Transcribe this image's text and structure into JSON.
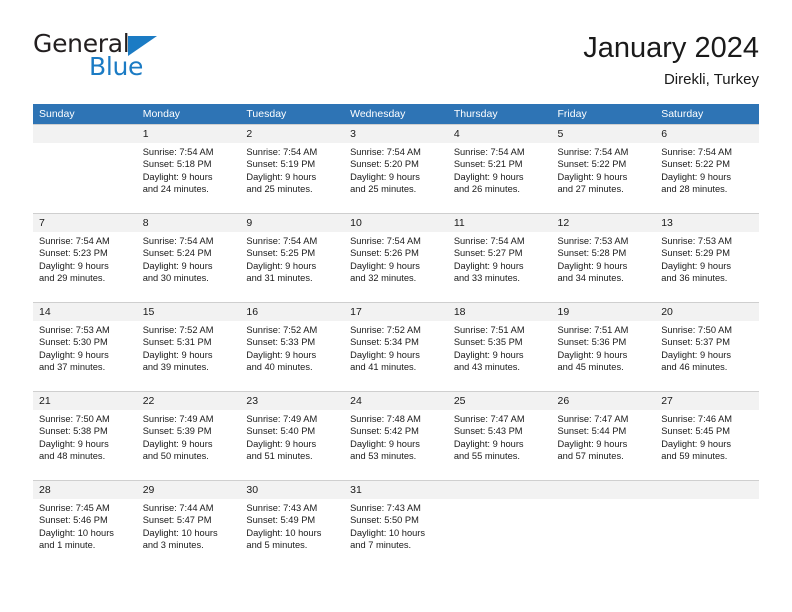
{
  "brand": {
    "name_top": "General",
    "name_bottom": "Blue",
    "triangle_color": "#1b7bc4",
    "text_color": "#231f20"
  },
  "header": {
    "title": "January 2024",
    "subtitle": "Direkli, Turkey"
  },
  "theme": {
    "header_bg": "#2e74b5",
    "header_text": "#ffffff",
    "daynum_bg": "#f2f2f2",
    "cell_bg": "#ffffff",
    "grid_line": "#cfcfcf",
    "text": "#1a1a1a"
  },
  "calendar": {
    "columns": [
      "Sunday",
      "Monday",
      "Tuesday",
      "Wednesday",
      "Thursday",
      "Friday",
      "Saturday"
    ],
    "weeks": [
      [
        {
          "day": "",
          "lines": []
        },
        {
          "day": "1",
          "lines": [
            "Sunrise: 7:54 AM",
            "Sunset: 5:18 PM",
            "Daylight: 9 hours",
            "and 24 minutes."
          ]
        },
        {
          "day": "2",
          "lines": [
            "Sunrise: 7:54 AM",
            "Sunset: 5:19 PM",
            "Daylight: 9 hours",
            "and 25 minutes."
          ]
        },
        {
          "day": "3",
          "lines": [
            "Sunrise: 7:54 AM",
            "Sunset: 5:20 PM",
            "Daylight: 9 hours",
            "and 25 minutes."
          ]
        },
        {
          "day": "4",
          "lines": [
            "Sunrise: 7:54 AM",
            "Sunset: 5:21 PM",
            "Daylight: 9 hours",
            "and 26 minutes."
          ]
        },
        {
          "day": "5",
          "lines": [
            "Sunrise: 7:54 AM",
            "Sunset: 5:22 PM",
            "Daylight: 9 hours",
            "and 27 minutes."
          ]
        },
        {
          "day": "6",
          "lines": [
            "Sunrise: 7:54 AM",
            "Sunset: 5:22 PM",
            "Daylight: 9 hours",
            "and 28 minutes."
          ]
        }
      ],
      [
        {
          "day": "7",
          "lines": [
            "Sunrise: 7:54 AM",
            "Sunset: 5:23 PM",
            "Daylight: 9 hours",
            "and 29 minutes."
          ]
        },
        {
          "day": "8",
          "lines": [
            "Sunrise: 7:54 AM",
            "Sunset: 5:24 PM",
            "Daylight: 9 hours",
            "and 30 minutes."
          ]
        },
        {
          "day": "9",
          "lines": [
            "Sunrise: 7:54 AM",
            "Sunset: 5:25 PM",
            "Daylight: 9 hours",
            "and 31 minutes."
          ]
        },
        {
          "day": "10",
          "lines": [
            "Sunrise: 7:54 AM",
            "Sunset: 5:26 PM",
            "Daylight: 9 hours",
            "and 32 minutes."
          ]
        },
        {
          "day": "11",
          "lines": [
            "Sunrise: 7:54 AM",
            "Sunset: 5:27 PM",
            "Daylight: 9 hours",
            "and 33 minutes."
          ]
        },
        {
          "day": "12",
          "lines": [
            "Sunrise: 7:53 AM",
            "Sunset: 5:28 PM",
            "Daylight: 9 hours",
            "and 34 minutes."
          ]
        },
        {
          "day": "13",
          "lines": [
            "Sunrise: 7:53 AM",
            "Sunset: 5:29 PM",
            "Daylight: 9 hours",
            "and 36 minutes."
          ]
        }
      ],
      [
        {
          "day": "14",
          "lines": [
            "Sunrise: 7:53 AM",
            "Sunset: 5:30 PM",
            "Daylight: 9 hours",
            "and 37 minutes."
          ]
        },
        {
          "day": "15",
          "lines": [
            "Sunrise: 7:52 AM",
            "Sunset: 5:31 PM",
            "Daylight: 9 hours",
            "and 39 minutes."
          ]
        },
        {
          "day": "16",
          "lines": [
            "Sunrise: 7:52 AM",
            "Sunset: 5:33 PM",
            "Daylight: 9 hours",
            "and 40 minutes."
          ]
        },
        {
          "day": "17",
          "lines": [
            "Sunrise: 7:52 AM",
            "Sunset: 5:34 PM",
            "Daylight: 9 hours",
            "and 41 minutes."
          ]
        },
        {
          "day": "18",
          "lines": [
            "Sunrise: 7:51 AM",
            "Sunset: 5:35 PM",
            "Daylight: 9 hours",
            "and 43 minutes."
          ]
        },
        {
          "day": "19",
          "lines": [
            "Sunrise: 7:51 AM",
            "Sunset: 5:36 PM",
            "Daylight: 9 hours",
            "and 45 minutes."
          ]
        },
        {
          "day": "20",
          "lines": [
            "Sunrise: 7:50 AM",
            "Sunset: 5:37 PM",
            "Daylight: 9 hours",
            "and 46 minutes."
          ]
        }
      ],
      [
        {
          "day": "21",
          "lines": [
            "Sunrise: 7:50 AM",
            "Sunset: 5:38 PM",
            "Daylight: 9 hours",
            "and 48 minutes."
          ]
        },
        {
          "day": "22",
          "lines": [
            "Sunrise: 7:49 AM",
            "Sunset: 5:39 PM",
            "Daylight: 9 hours",
            "and 50 minutes."
          ]
        },
        {
          "day": "23",
          "lines": [
            "Sunrise: 7:49 AM",
            "Sunset: 5:40 PM",
            "Daylight: 9 hours",
            "and 51 minutes."
          ]
        },
        {
          "day": "24",
          "lines": [
            "Sunrise: 7:48 AM",
            "Sunset: 5:42 PM",
            "Daylight: 9 hours",
            "and 53 minutes."
          ]
        },
        {
          "day": "25",
          "lines": [
            "Sunrise: 7:47 AM",
            "Sunset: 5:43 PM",
            "Daylight: 9 hours",
            "and 55 minutes."
          ]
        },
        {
          "day": "26",
          "lines": [
            "Sunrise: 7:47 AM",
            "Sunset: 5:44 PM",
            "Daylight: 9 hours",
            "and 57 minutes."
          ]
        },
        {
          "day": "27",
          "lines": [
            "Sunrise: 7:46 AM",
            "Sunset: 5:45 PM",
            "Daylight: 9 hours",
            "and 59 minutes."
          ]
        }
      ],
      [
        {
          "day": "28",
          "lines": [
            "Sunrise: 7:45 AM",
            "Sunset: 5:46 PM",
            "Daylight: 10 hours",
            "and 1 minute."
          ]
        },
        {
          "day": "29",
          "lines": [
            "Sunrise: 7:44 AM",
            "Sunset: 5:47 PM",
            "Daylight: 10 hours",
            "and 3 minutes."
          ]
        },
        {
          "day": "30",
          "lines": [
            "Sunrise: 7:43 AM",
            "Sunset: 5:49 PM",
            "Daylight: 10 hours",
            "and 5 minutes."
          ]
        },
        {
          "day": "31",
          "lines": [
            "Sunrise: 7:43 AM",
            "Sunset: 5:50 PM",
            "Daylight: 10 hours",
            "and 7 minutes."
          ]
        },
        {
          "day": "",
          "lines": []
        },
        {
          "day": "",
          "lines": []
        },
        {
          "day": "",
          "lines": []
        }
      ]
    ]
  }
}
